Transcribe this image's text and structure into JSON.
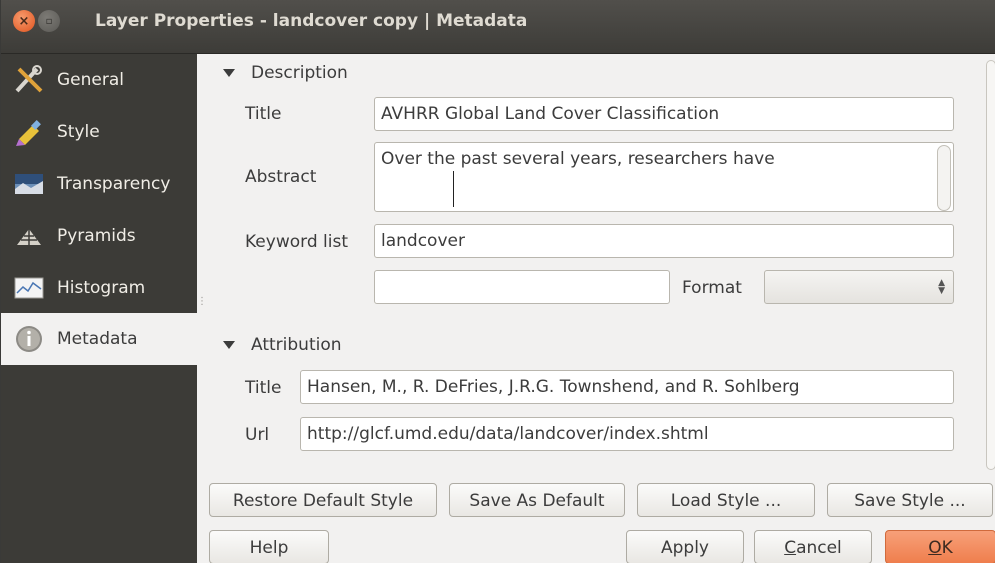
{
  "window": {
    "title": "Layer Properties - landcover copy | Metadata",
    "close_glyph": "×",
    "minimize_glyph": "▫"
  },
  "sidebar": {
    "items": [
      {
        "label": "General",
        "icon": "tools-icon"
      },
      {
        "label": "Style",
        "icon": "paintbrush-icon"
      },
      {
        "label": "Transparency",
        "icon": "transparency-icon"
      },
      {
        "label": "Pyramids",
        "icon": "pyramids-icon"
      },
      {
        "label": "Histogram",
        "icon": "histogram-icon"
      },
      {
        "label": "Metadata",
        "icon": "info-icon",
        "active": true
      }
    ]
  },
  "description": {
    "header": "Description",
    "title_label": "Title",
    "title_value": "AVHRR Global Land Cover Classification",
    "abstract_label": "Abstract",
    "abstract_value": "Over the past several years, researchers have",
    "keyword_label": "Keyword list",
    "keyword_value": "landcover",
    "extra_value": "",
    "format_label": "Format",
    "format_value": ""
  },
  "attribution": {
    "header": "Attribution",
    "title_label": "Title",
    "title_value": "Hansen, M., R. DeFries, J.R.G. Townshend, and R. Sohlberg",
    "url_label": "Url",
    "url_value": "http://glcf.umd.edu/data/landcover/index.shtml"
  },
  "buttons": {
    "restore_default_style": "Restore Default Style",
    "save_as_default": "Save As Default",
    "load_style": "Load Style ...",
    "save_style": "Save Style ...",
    "help": "Help",
    "apply": "Apply",
    "cancel_prefix": "C",
    "cancel_rest": "ancel",
    "ok_prefix": "O",
    "ok_rest": "K"
  },
  "colors": {
    "titlebar": "#3d3c38",
    "sidebar": "#3c3b37",
    "accent_ok": "#ef7e4d",
    "close_button": "#e0541f"
  }
}
